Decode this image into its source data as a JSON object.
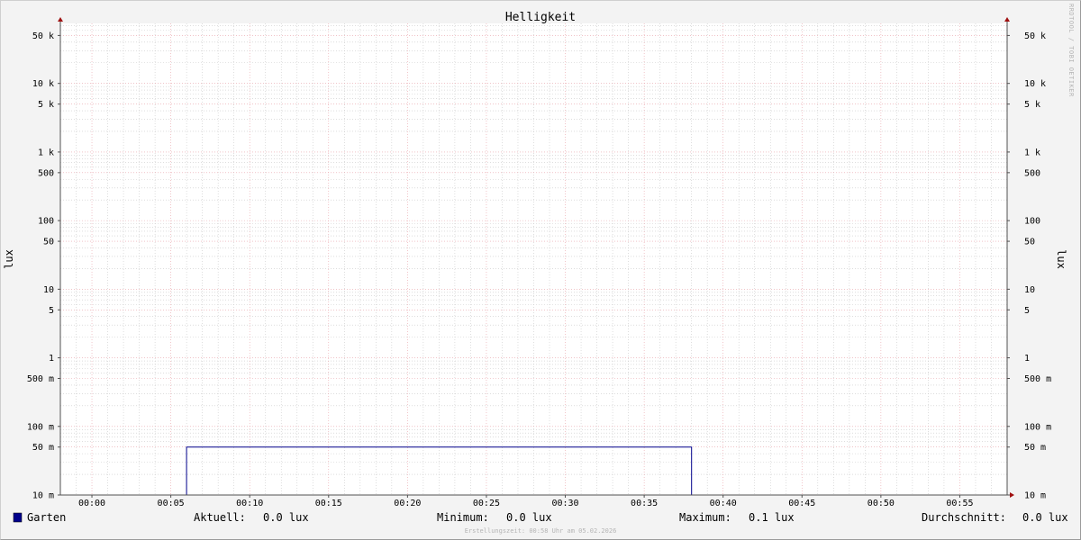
{
  "colors": {
    "background": "#f3f3f3",
    "canvas": "#ffffff",
    "major_grid": "#e8a0a8",
    "minor_grid": "#c9c9c9",
    "axis": "#505050",
    "arrow": "#a01010",
    "series": "#00008b"
  },
  "watermark": "RRDTOOL / TOBI OETIKER",
  "footer": "Erstellungszeit: 00:58 Uhr am 05.02.2026",
  "legend": {
    "series_name": "Garten",
    "aktuell_label": "Aktuell:",
    "aktuell_value": "0.0 lux",
    "minimum_label": "Minimum:",
    "minimum_value": "0.0 lux",
    "maximum_label": "Maximum:",
    "maximum_value": "0.1 lux",
    "durchschnitt_label": "Durchschnitt:",
    "durchschnitt_value": "0.0 lux"
  },
  "chart_data": {
    "type": "line",
    "title": "Helligkeit",
    "ylabel": "lux",
    "yscale": "log",
    "ylim": [
      0.01,
      75000
    ],
    "xlim": [
      "23:58",
      "00:58"
    ],
    "grid": true,
    "x_ticks": [
      "00:00",
      "00:05",
      "00:10",
      "00:15",
      "00:20",
      "00:25",
      "00:30",
      "00:35",
      "00:40",
      "00:45",
      "00:50",
      "00:55"
    ],
    "y_ticks": [
      {
        "value": 50000,
        "label": "50 k"
      },
      {
        "value": 10000,
        "label": "10 k"
      },
      {
        "value": 5000,
        "label": "5 k"
      },
      {
        "value": 1000,
        "label": "1 k"
      },
      {
        "value": 500,
        "label": "500"
      },
      {
        "value": 100,
        "label": "100"
      },
      {
        "value": 50,
        "label": "50"
      },
      {
        "value": 10,
        "label": "10"
      },
      {
        "value": 5,
        "label": "5"
      },
      {
        "value": 1,
        "label": "1"
      },
      {
        "value": 0.5,
        "label": "500 m"
      },
      {
        "value": 0.1,
        "label": "100 m"
      },
      {
        "value": 0.05,
        "label": "50 m"
      },
      {
        "value": 0.01,
        "label": "10 m"
      }
    ],
    "series": [
      {
        "name": "Garten",
        "color": "#00008b",
        "points": [
          {
            "x": "23:58",
            "y": 0.01
          },
          {
            "x": "00:06",
            "y": 0.01
          },
          {
            "x": "00:06",
            "y": 0.05
          },
          {
            "x": "00:38",
            "y": 0.05
          },
          {
            "x": "00:38",
            "y": 0.01
          },
          {
            "x": "00:58",
            "y": 0.01
          }
        ]
      }
    ]
  }
}
